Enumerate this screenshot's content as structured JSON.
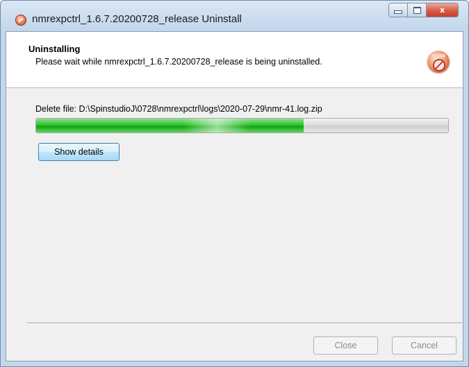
{
  "window": {
    "title": "nmrexpctrl_1.6.7.20200728_release Uninstall",
    "app_icon": "uninstaller-icon",
    "controls": {
      "minimize": "minimize-icon",
      "maximize": "maximize-icon",
      "close_glyph": "x"
    }
  },
  "header": {
    "title": "Uninstalling",
    "subtitle": "Please wait while nmrexpctrl_1.6.7.20200728_release is being uninstalled.",
    "icon": "uninstall-disc-icon"
  },
  "status": {
    "text": "Delete file: D:\\SpinstudioJ\\0728\\nmrexpctrl\\logs\\2020-07-29\\nmr-41.log.zip"
  },
  "progress": {
    "percent": 65,
    "color": "#22b322"
  },
  "buttons": {
    "show_details": "Show details",
    "close": "Close",
    "cancel": "Cancel"
  }
}
